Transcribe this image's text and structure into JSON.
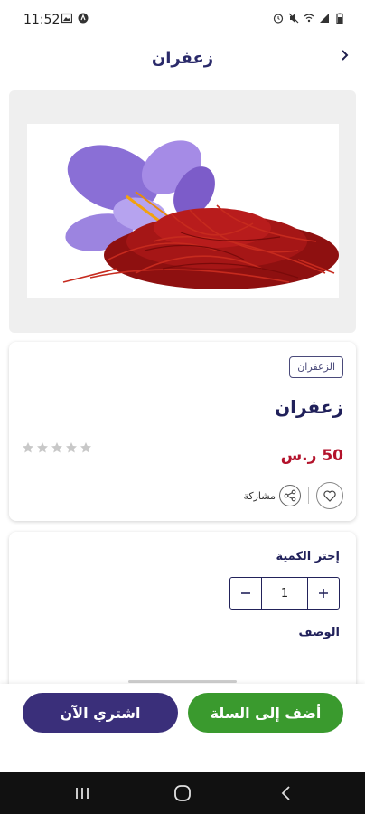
{
  "status_bar": {
    "time": "11:52",
    "left_icons": [
      "gallery-icon",
      "app-notification-icon"
    ],
    "right_icons": [
      "alarm-icon",
      "mute-icon",
      "wifi-icon",
      "signal-icon",
      "battery-icon"
    ]
  },
  "header": {
    "title": "زعفران",
    "back_icon": "chevron-right-icon"
  },
  "product": {
    "image_alt": "saffron-flower-image",
    "category": "الزعفران",
    "name": "زعفران",
    "price": "50 ر.س",
    "rating_stars": 0,
    "rating_max": 5,
    "share_label": "مشاركة",
    "favorite_icon": "heart-icon",
    "share_icon": "share-icon"
  },
  "quantity": {
    "label": "إختر الكمية",
    "value": "1",
    "increment_icon": "plus-icon",
    "decrement_icon": "minus-icon"
  },
  "description": {
    "label": "الوصف"
  },
  "actions": {
    "add_to_cart": "أضف إلى السلة",
    "buy_now": "اشتري الآن"
  },
  "colors": {
    "primary": "#3a2f7a",
    "accent_green": "#3a9a2e",
    "price_red": "#b3122b",
    "star_gray": "#c8c8c8"
  },
  "nav_bar": {
    "buttons": [
      "recents-icon",
      "home-icon",
      "back-icon"
    ]
  }
}
